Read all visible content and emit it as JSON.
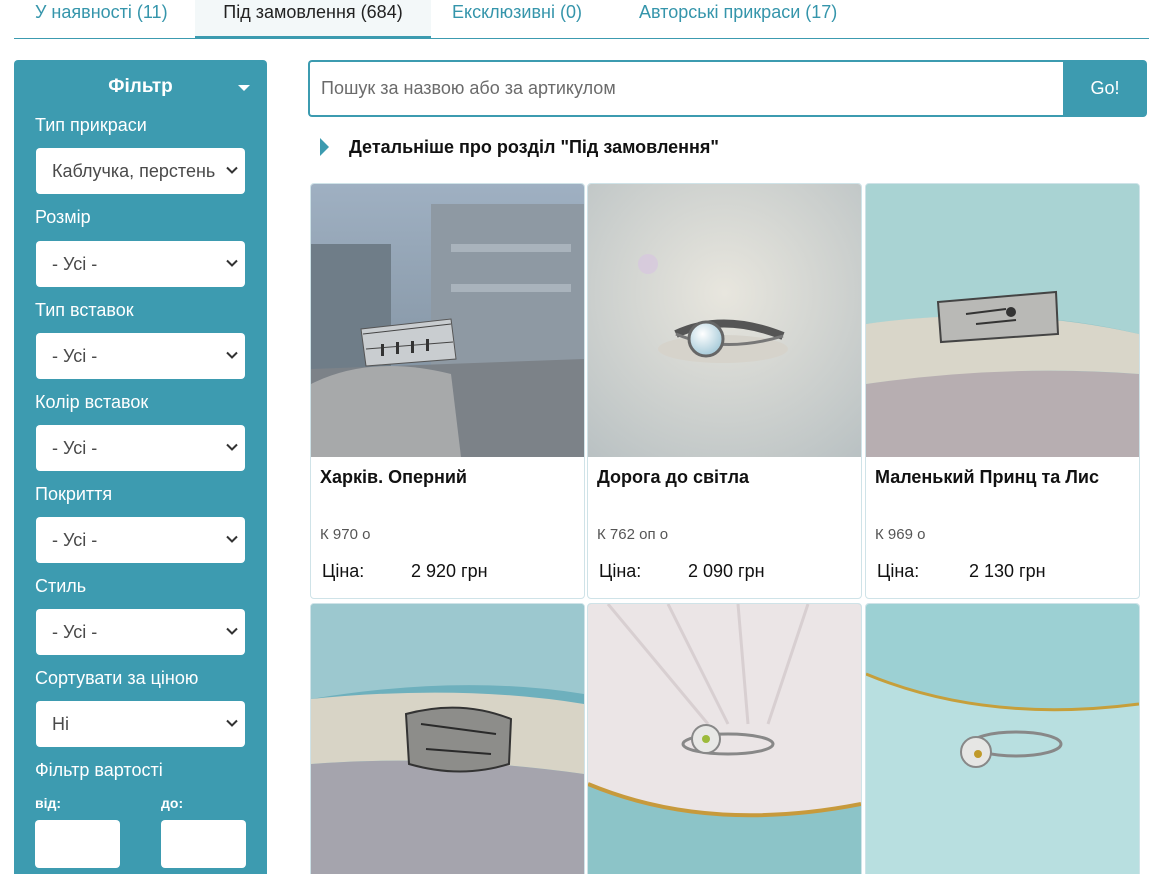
{
  "tabs": [
    {
      "label": "У наявності (11)",
      "active": false
    },
    {
      "label": "Під замовлення (684)",
      "active": true
    },
    {
      "label": "Ексклюзивні (0)",
      "active": false
    },
    {
      "label": "Авторські прикраси (17)",
      "active": false
    }
  ],
  "filter": {
    "title": "Фільтр",
    "fields": [
      {
        "label": "Тип прикраси",
        "value": "Каблучка, перстень"
      },
      {
        "label": "Розмір",
        "value": "- Усі -"
      },
      {
        "label": "Тип вставок",
        "value": "- Усі -"
      },
      {
        "label": "Колір вставок",
        "value": "- Усі -"
      },
      {
        "label": "Покриття",
        "value": "- Усі -"
      },
      {
        "label": "Стиль",
        "value": "- Усі -"
      },
      {
        "label": "Сортувати за ціною",
        "value": "Ні"
      }
    ],
    "price_filter": {
      "label": "Фільтр вартості",
      "from_label": "від:",
      "to_label": "до:",
      "from_value": "",
      "to_value": ""
    }
  },
  "search": {
    "placeholder": "Пошук за назвою або за артикулом",
    "button": "Go!"
  },
  "detail_link": "Детальніше про розділ \"Під замовлення\"",
  "products": [
    {
      "title": "Харків. Оперний",
      "sku": "К 970 о",
      "price_label": "Ціна:",
      "price": "2 920 грн"
    },
    {
      "title": "Дорога до світла",
      "sku": "К 762 оп о",
      "price_label": "Ціна:",
      "price": "2 090 грн"
    },
    {
      "title": "Маленький Принц та Лис",
      "sku": "К 969 о",
      "price_label": "Ціна:",
      "price": "2 130 грн"
    },
    {
      "title": "",
      "sku": "",
      "price_label": "",
      "price": ""
    },
    {
      "title": "",
      "sku": "",
      "price_label": "",
      "price": ""
    },
    {
      "title": "",
      "sku": "",
      "price_label": "",
      "price": ""
    }
  ],
  "colors": {
    "accent": "#3d9bb0",
    "tab_text": "#3595ab"
  }
}
